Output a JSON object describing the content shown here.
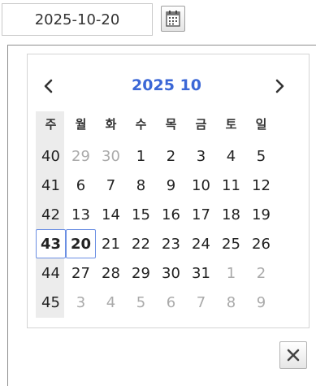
{
  "date_field": {
    "value": "2025-10-20"
  },
  "calendar": {
    "title": "2025 10",
    "prev_label": "‹",
    "next_label": "›",
    "week_header": "주",
    "day_headers": [
      "월",
      "화",
      "수",
      "목",
      "금",
      "토",
      "일"
    ],
    "weeks": [
      {
        "week": "40",
        "days": [
          {
            "d": "29",
            "other": true
          },
          {
            "d": "30",
            "other": true
          },
          {
            "d": "1"
          },
          {
            "d": "2"
          },
          {
            "d": "3"
          },
          {
            "d": "4"
          },
          {
            "d": "5"
          }
        ]
      },
      {
        "week": "41",
        "days": [
          {
            "d": "6"
          },
          {
            "d": "7"
          },
          {
            "d": "8"
          },
          {
            "d": "9"
          },
          {
            "d": "10"
          },
          {
            "d": "11"
          },
          {
            "d": "12"
          }
        ]
      },
      {
        "week": "42",
        "days": [
          {
            "d": "13"
          },
          {
            "d": "14"
          },
          {
            "d": "15"
          },
          {
            "d": "16"
          },
          {
            "d": "17"
          },
          {
            "d": "18"
          },
          {
            "d": "19"
          }
        ]
      },
      {
        "week": "43",
        "selected": true,
        "days": [
          {
            "d": "20",
            "selected": true
          },
          {
            "d": "21"
          },
          {
            "d": "22"
          },
          {
            "d": "23"
          },
          {
            "d": "24"
          },
          {
            "d": "25"
          },
          {
            "d": "26"
          }
        ]
      },
      {
        "week": "44",
        "days": [
          {
            "d": "27"
          },
          {
            "d": "28"
          },
          {
            "d": "29"
          },
          {
            "d": "30"
          },
          {
            "d": "31"
          },
          {
            "d": "1",
            "other": true
          },
          {
            "d": "2",
            "other": true
          }
        ]
      },
      {
        "week": "45",
        "days": [
          {
            "d": "3",
            "other": true
          },
          {
            "d": "4",
            "other": true
          },
          {
            "d": "5",
            "other": true
          },
          {
            "d": "6",
            "other": true
          },
          {
            "d": "7",
            "other": true
          },
          {
            "d": "8",
            "other": true
          },
          {
            "d": "9",
            "other": true
          }
        ]
      }
    ]
  },
  "colors": {
    "accent": "#3b67d6",
    "selection_border": "#6b8fe3",
    "muted": "#aaaaaa"
  },
  "icons": {
    "calendar": "calendar-icon",
    "prev": "chevron-left-icon",
    "next": "chevron-right-icon",
    "close": "close-icon"
  }
}
